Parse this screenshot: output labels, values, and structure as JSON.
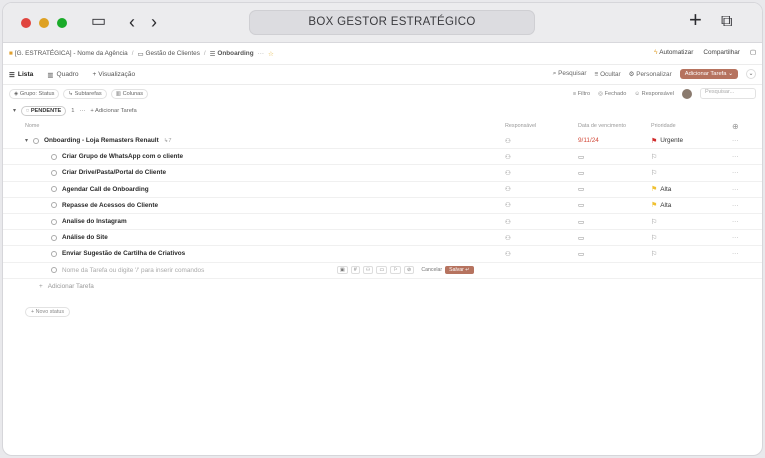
{
  "window": {
    "title": "BOX GESTOR ESTRATÉGICO",
    "colors": {
      "close": "#e0443e",
      "min": "#dea123",
      "max": "#1aab29"
    }
  },
  "breadcrumbs": {
    "items": [
      "[G. ESTRATÉGICA] - Nome da Agência",
      "Gestão de Clientes",
      "Onboarding"
    ],
    "more": "···",
    "automate": "Automatizar",
    "share": "Compartilhar"
  },
  "toolbar": {
    "tabs": [
      "Lista",
      "Quadro",
      "+ Visualização"
    ],
    "search": "Pesquisar",
    "hide": "Ocultar",
    "customize": "Personalizar",
    "add_task": "Adicionar Tarefa"
  },
  "filters": {
    "group": "Grupo: Status",
    "subtasks": "Subtarefas",
    "columns": "Colunas",
    "filter": "Filtro",
    "closed": "Fechado",
    "assignee": "Responsável",
    "search_placeholder": "Pesquisar..."
  },
  "group": {
    "status": "PENDENTE",
    "count": "1",
    "more": "···",
    "add": "+ Adicionar Tarefa"
  },
  "columns": {
    "name": "Nome",
    "assignee": "Responsável",
    "due": "Data de vencimento",
    "priority": "Prioridade"
  },
  "tasks": [
    {
      "name": "Onboarding - Loja Remasters Renault",
      "subcount": "7",
      "due": "9/11/24",
      "priority": "Urgente"
    },
    {
      "name": "Criar Grupo de WhatsApp com o cliente",
      "priority": ""
    },
    {
      "name": "Criar Drive/Pasta/Portal do Cliente",
      "priority": ""
    },
    {
      "name": "Agendar Call de Onboarding",
      "priority": "Alta"
    },
    {
      "name": "Repasse de Acessos do Cliente",
      "priority": "Alta"
    },
    {
      "name": "Analise do Instagram",
      "priority": ""
    },
    {
      "name": "Análise do Site",
      "priority": ""
    },
    {
      "name": "Enviar Sugestão de Cartilha de Criativos",
      "priority": ""
    }
  ],
  "input_row": {
    "placeholder": "Nome da Tarefa ou digite '/' para inserir comandos",
    "cancel": "Cancelar",
    "save": "Salvar ↵"
  },
  "add_task_row": "Adicionar Tarefa",
  "new_status": "+ Novo status"
}
